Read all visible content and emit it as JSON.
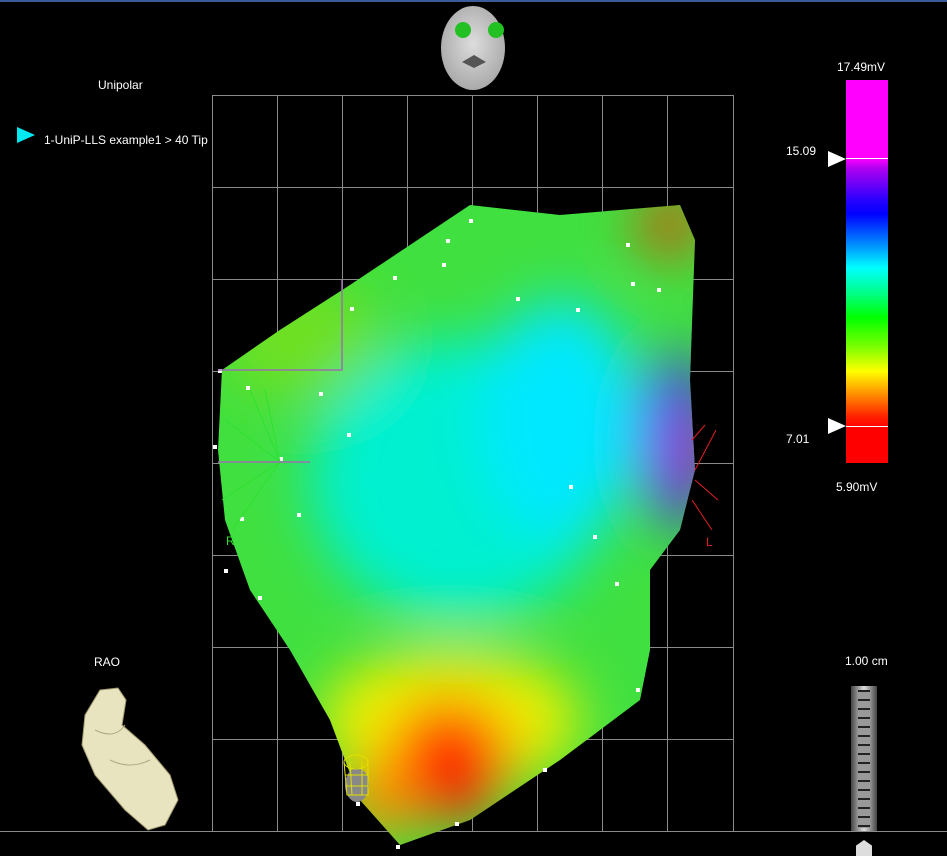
{
  "view": {
    "map_type": "Unipolar",
    "map_label": "1-UniP-LLS example1 > 40 Tip",
    "orientation": "RAO",
    "left_marker": "R",
    "right_marker": "L"
  },
  "colorbar": {
    "max_label": "17.49mV",
    "min_label": "5.90mV",
    "upper_threshold": "15.09",
    "lower_threshold": "7.01",
    "colors": [
      "#ff00ff",
      "#0000ff",
      "#00ffff",
      "#00ff00",
      "#ffff00",
      "#ff0000"
    ]
  },
  "scale": {
    "label": "1.00 cm"
  }
}
